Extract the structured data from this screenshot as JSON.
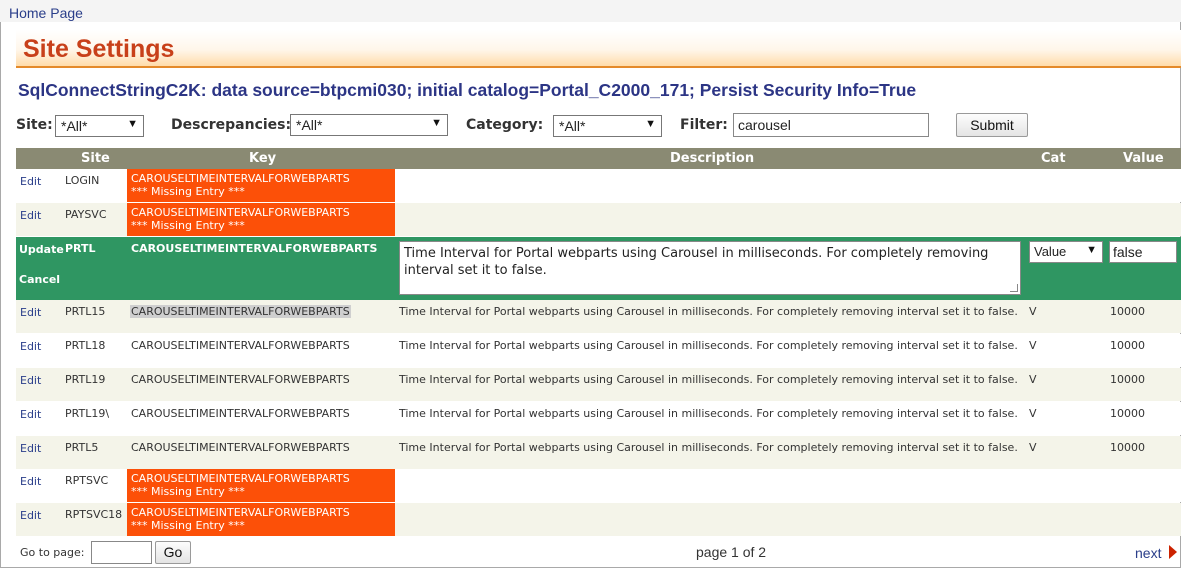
{
  "nav": {
    "home": "Home Page"
  },
  "page": {
    "title": "Site Settings",
    "connection_string": "SqlConnectStringC2K: data source=btpcmi030; initial catalog=Portal_C2000_171; Persist Security Info=True"
  },
  "filters": {
    "site_label": "Site:",
    "site_value": "*All*",
    "discrepancies_label": "Descrepancies:",
    "discrepancies_value": "*All*",
    "category_label": "Category:",
    "category_value": "*All*",
    "filter_label": "Filter:",
    "filter_value": "carousel",
    "submit": "Submit"
  },
  "grid": {
    "columns": {
      "site": "Site",
      "key": "Key",
      "description": "Description",
      "cat": "Cat",
      "value": "Value"
    },
    "missing_text": "*** Missing Entry ***",
    "edit_label": "Edit",
    "rows": [
      {
        "site": "LOGIN",
        "key": "CAROUSELTIMEINTERVALFORWEBPARTS",
        "missing": true
      },
      {
        "site": "PAYSVC",
        "key": "CAROUSELTIMEINTERVALFORWEBPARTS",
        "missing": true
      },
      {
        "site": "PRTL15",
        "key": "CAROUSELTIMEINTERVALFORWEBPARTS",
        "description": "Time Interval for Portal webparts using Carousel in milliseconds. For completely removing interval set it to false.",
        "cat": "V",
        "value": "10000"
      },
      {
        "site": "PRTL18",
        "key": "CAROUSELTIMEINTERVALFORWEBPARTS",
        "description": "Time Interval for Portal webparts using Carousel in milliseconds. For completely removing interval set it to false.",
        "cat": "V",
        "value": "10000"
      },
      {
        "site": "PRTL19",
        "key": "CAROUSELTIMEINTERVALFORWEBPARTS",
        "description": "Time Interval for Portal webparts using Carousel in milliseconds. For completely removing interval set it to false.",
        "cat": "V",
        "value": "10000"
      },
      {
        "site": "PRTL19\\",
        "key": "CAROUSELTIMEINTERVALFORWEBPARTS",
        "description": "Time Interval for Portal webparts using Carousel in milliseconds. For completely removing interval set it to false.",
        "cat": "V",
        "value": "10000"
      },
      {
        "site": "PRTL5",
        "key": "CAROUSELTIMEINTERVALFORWEBPARTS",
        "description": "Time Interval for Portal webparts using Carousel in milliseconds. For completely removing interval set it to false.",
        "cat": "V",
        "value": "10000"
      },
      {
        "site": "RPTSVC",
        "key": "CAROUSELTIMEINTERVALFORWEBPARTS",
        "missing": true
      },
      {
        "site": "RPTSVC18",
        "key": "CAROUSELTIMEINTERVALFORWEBPARTS",
        "missing": true
      }
    ],
    "editing_row": {
      "update": "Update",
      "cancel": "Cancel",
      "site": "PRTL",
      "key": "CAROUSELTIMEINTERVALFORWEBPARTS",
      "description": "Time Interval for Portal webparts using Carousel in milliseconds. For completely removing interval set it to false.",
      "cat": "Value",
      "value": "false"
    }
  },
  "footer": {
    "goto_label": "Go to page:",
    "goto_value": "",
    "go_button": "Go",
    "page_info": "page 1 of 2",
    "next": "next"
  }
}
